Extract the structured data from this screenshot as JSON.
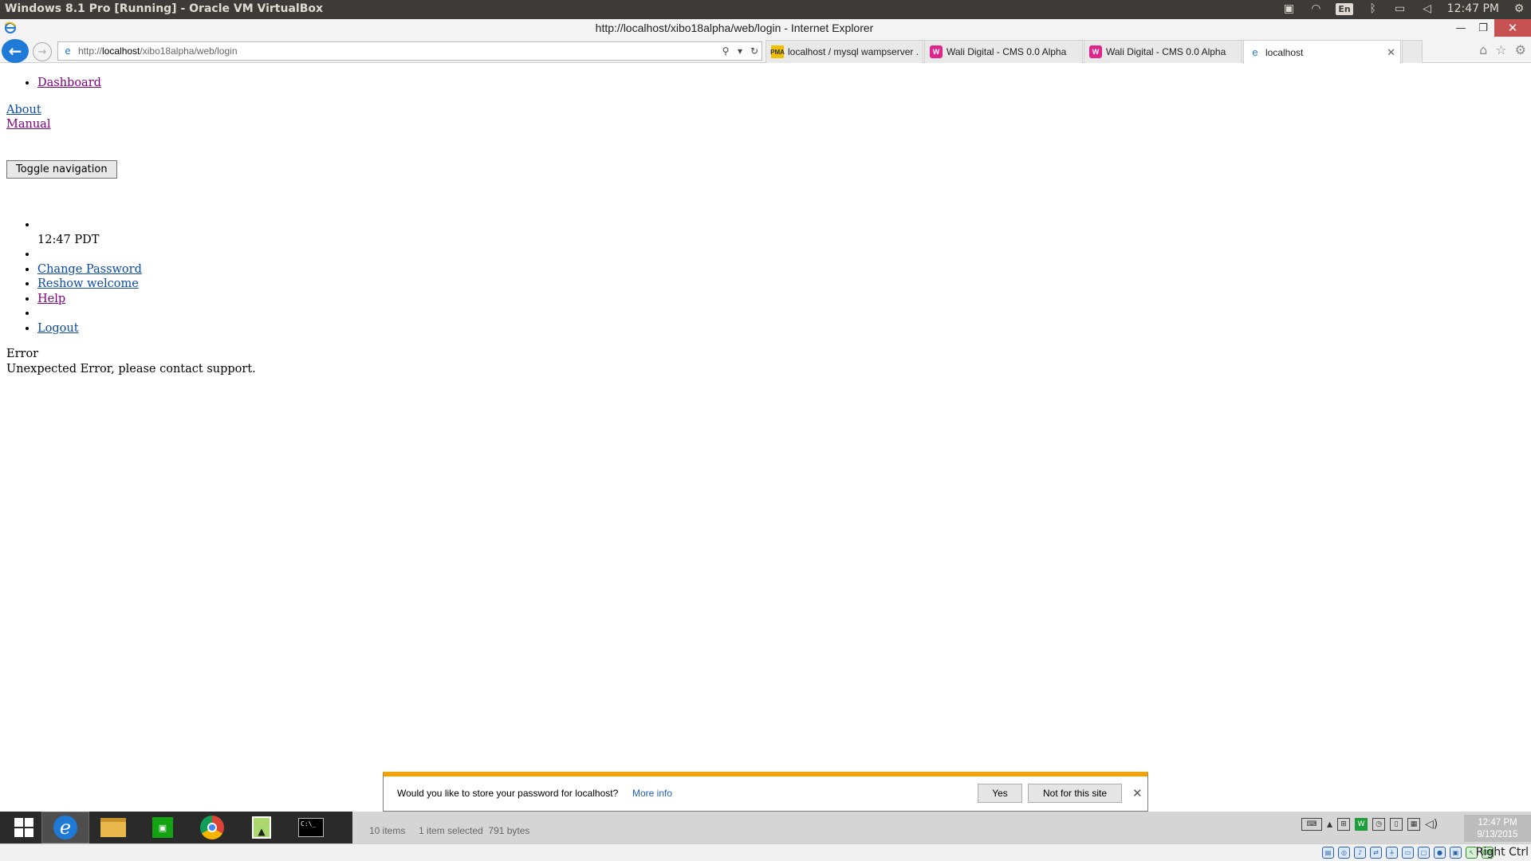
{
  "host": {
    "title": "Windows 8.1 Pro [Running] - Oracle VM VirtualBox",
    "lang": "En",
    "clock": "12:47 PM"
  },
  "ie": {
    "window_title": "http://localhost/xibo18alpha/web/login - Internet Explorer",
    "address": {
      "prefix": "http://",
      "host": "localhost",
      "path": "/xibo18alpha/web/login"
    },
    "tabs": [
      {
        "label": "localhost / mysql wampserver ...",
        "icon": "pma-icon",
        "active": false
      },
      {
        "label": "Wali Digital - CMS 0.0 Alpha",
        "icon": "wali-icon",
        "active": false
      },
      {
        "label": "Wali Digital - CMS 0.0 Alpha",
        "icon": "wali-icon",
        "active": false
      },
      {
        "label": "localhost",
        "icon": "ie-icon",
        "active": true
      }
    ]
  },
  "page": {
    "nav_top": [
      "Dashboard"
    ],
    "links": [
      "About",
      "Manual"
    ],
    "toggle_label": "Toggle navigation",
    "clock": "12:47 PM",
    "clock_text": "12:47 PDT",
    "user_menu": [
      "Change Password",
      "Reshow welcome",
      "Help",
      "Logout"
    ],
    "error_title": "Error",
    "error_message": "Unexpected Error, please contact support."
  },
  "notification": {
    "message": "Would you like to store your password for localhost?",
    "more_info": "More info",
    "yes": "Yes",
    "no": "Not for this site"
  },
  "taskbar": {
    "status": "10 items     1 item selected  791 bytes",
    "time": "12:47 PM",
    "date": "9/13/2015"
  },
  "vbox": {
    "host_key": "Right Ctrl"
  },
  "colors": {
    "link": "#0b4aa8",
    "visited": "#800080",
    "accent": "#1e7ad6",
    "notification_bar": "#f0a30a"
  }
}
